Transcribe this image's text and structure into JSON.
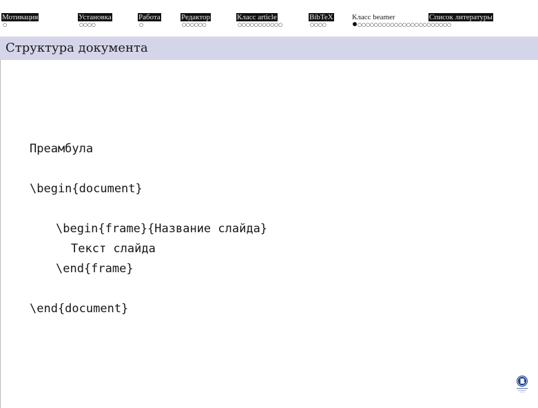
{
  "nav": {
    "sections": [
      {
        "label": "Мотивация",
        "dots": "○",
        "active": false
      },
      {
        "label": "Установка",
        "dots": "○○○○",
        "active": false
      },
      {
        "label": "Работа",
        "dots": "○",
        "active": false
      },
      {
        "label": "Редактор",
        "dots": "○○○○○○",
        "active": false
      },
      {
        "label": "Класс article",
        "dots": "○○○○○○○○○○○",
        "active": false
      },
      {
        "label": "BibTeX",
        "dots": "○○○○",
        "active": false
      },
      {
        "label": "Класс beamer",
        "dots": "○○○○○○○○○○○○○○○○○○○○○○○",
        "active": true
      },
      {
        "label": "Список литературы",
        "dots": "",
        "active": false
      }
    ]
  },
  "title": "Структура документа",
  "code": {
    "lines": [
      "Преамбула",
      "\\begin{document}",
      "\\begin{frame}{Название слайда}",
      "Текст слайда",
      "\\end{frame}",
      "\\end{document}"
    ]
  },
  "colors": {
    "titlebar_bg": "#d5d5ea",
    "nav_inactive_bg": "#111111",
    "logo_blue": "#1b3f8f"
  },
  "icons": {
    "logo": "university-crest-icon"
  }
}
